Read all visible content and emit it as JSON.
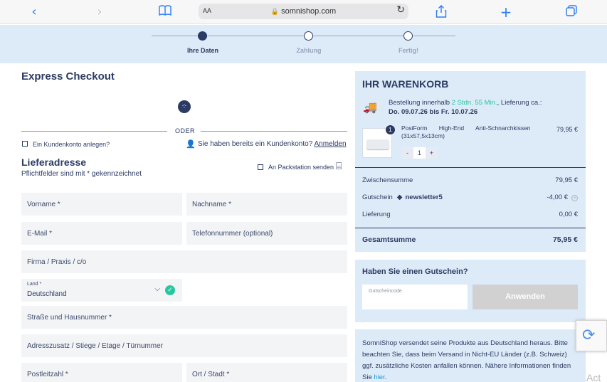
{
  "browser": {
    "back_icon": "chevron-left-icon",
    "forward_icon": "chevron-right-icon",
    "reader_aa": "AA",
    "url": "somnishop.com"
  },
  "stepper": {
    "steps": [
      {
        "label": "Ihre Daten",
        "active": true
      },
      {
        "label": "Zahlung",
        "active": false
      },
      {
        "label": "Fertig!",
        "active": false
      }
    ]
  },
  "checkout": {
    "title": "Express Checkout",
    "divider": "ODER",
    "create_account": "Ein Kundenkonto anlegen?",
    "has_account": "Sie haben bereits ein Kundenkonto?",
    "login_link": "Anmelden"
  },
  "address": {
    "title": "Lieferadresse",
    "subtitle": "Pflichtfelder sind mit * gekennzeichnet",
    "packstation": "An Packstation senden",
    "fields": {
      "first_name": "Vorname *",
      "last_name": "Nachname *",
      "email": "E-Mail *",
      "phone": "Telefonnummer (optional)",
      "company": "Firma / Praxis / c/o",
      "country_label": "Land *",
      "country_value": "Deutschland",
      "street": "Straße und Hausnummer *",
      "address_extra": "Adresszusatz / Stiege / Etage / Türnummer",
      "zip": "Postleitzahl *",
      "city": "Ort / Stadt *"
    }
  },
  "cart": {
    "title": "IHR WARENKORB",
    "delivery_prefix": "Bestellung innerhalb",
    "delivery_time": "2 Stdn. 55 Min.",
    "delivery_suffix": ", Lieferung ca.:",
    "delivery_dates": "Do. 09.07.26 bis Fr. 10.07.26",
    "item": {
      "quantity_badge": "1",
      "name": "PosiForm High-End Anti-Schnarchkissen",
      "size": "(31x57,5x13cm)",
      "price": "79,95 €",
      "qty": "1",
      "minus": "-",
      "plus": "+"
    },
    "subtotal_label": "Zwischensumme",
    "subtotal": "79,95 €",
    "voucher_label": "Gutschein",
    "voucher_code": "newsletter5",
    "voucher_amount": "-4,00 €",
    "shipping_label": "Lieferung",
    "shipping": "0,00 €",
    "total_label": "Gesamtsumme",
    "total": "75,95 €"
  },
  "voucher": {
    "title": "Haben Sie einen Gutschein?",
    "placeholder": "Gutscheincode",
    "apply": "Anwenden"
  },
  "info": {
    "text": "SomniShop versendet seine Produkte aus Deutschland heraus. Bitte beachten Sie, dass beim Versand in Nicht-EU Länder (z.B. Schweiz) ggf. zusätzliche Kosten anfallen können. Nähere Informationen finden Sie",
    "link": "hier",
    "end": "."
  },
  "overlay": {
    "act_text": "Act"
  },
  "colors": {
    "brand_dark": "#2c3b63",
    "accent": "#27c7a0",
    "panel": "#ddeaf8",
    "link": "#1b9ad6"
  }
}
